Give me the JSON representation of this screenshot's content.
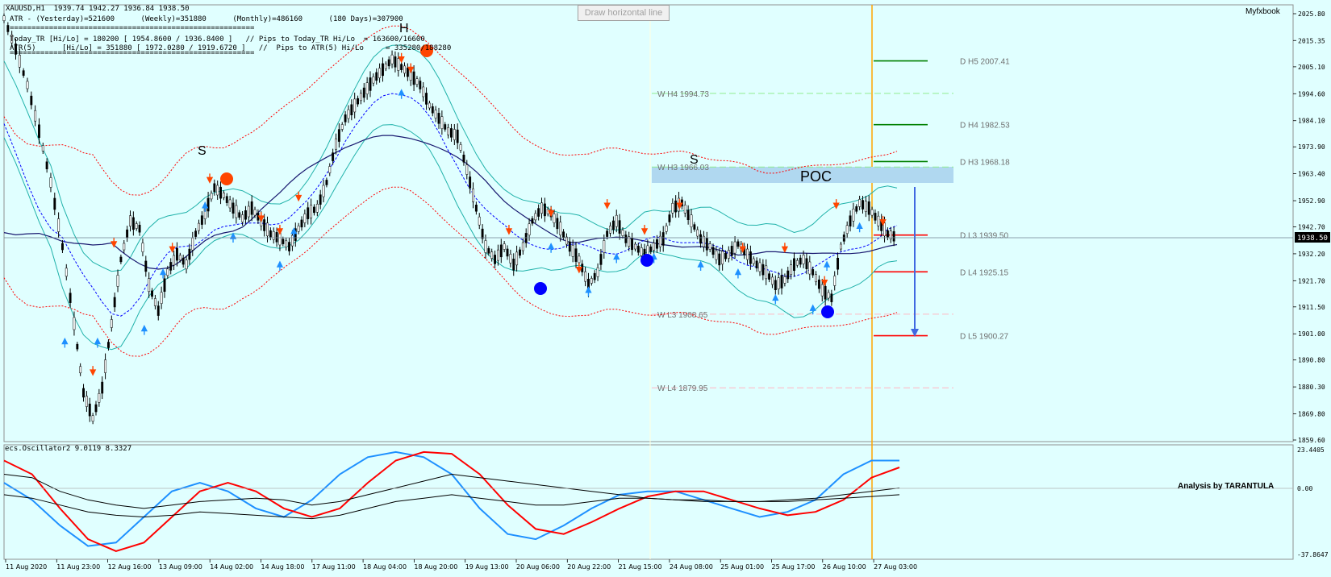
{
  "header": {
    "line1": "XAUUSD,H1  1939.74 1942.27 1936.84 1938.50",
    "line2": "ATR - (Yesterday)=521600      (Weekly)=351880      (Monthly)=486160      (180 Days)=307900",
    "line3": "========================================================",
    "line4": "Today_TR [Hi/Lo] = 180200 [ 1954.8600 / 1936.8400 ]   // Pips to Today_TR Hi/Lo  = 163600/16600",
    "line5": "ATR(5)      [Hi/Lo] = 351880 [ 1972.0280 / 1919.6720 ]   //  Pips to ATR(5) Hi/Lo     = 335280/188280",
    "line6": "========================================================"
  },
  "tooltip": "Draw horizontal line",
  "brand": "Myfxbook",
  "analysis": "Analysis by TARANTULA",
  "oscillator": {
    "title": "ecs.Oscillator2 9.0119 8.3327",
    "axis_labels": [
      "23.4405",
      "0.00",
      "-37.8647"
    ]
  },
  "colors": {
    "background": "#e0ffff",
    "bull_candle": "#000000",
    "bollinger": "#20b2aa",
    "envelope": "#ff0000",
    "ma": "#191970",
    "dotted_ma": "#0000ff",
    "arrow_down": "#ff4500",
    "arrow_up": "#1e90ff",
    "poc_zone": "#b0d8f0",
    "orange_line": "#ffa500"
  },
  "patterns": {
    "left_shoulder": "S",
    "head": "H",
    "right_shoulder": "S",
    "poc": "POC"
  },
  "chart_data": {
    "type": "candlestick",
    "symbol": "XAUUSD",
    "timeframe": "H1",
    "ylim": [
      1859.6,
      2025.8
    ],
    "y_ticks": [
      "2025.80",
      "2015.35",
      "2005.10",
      "1994.60",
      "1984.10",
      "1973.90",
      "1963.40",
      "1952.90",
      "1942.70",
      "1932.20",
      "1921.70",
      "1911.50",
      "1901.00",
      "1890.80",
      "1880.30",
      "1869.80",
      "1859.60"
    ],
    "last_price": "1938.50",
    "x_ticks": [
      "11 Aug 2020",
      "11 Aug 23:00",
      "12 Aug 16:00",
      "13 Aug 09:00",
      "14 Aug 02:00",
      "14 Aug 18:00",
      "17 Aug 11:00",
      "18 Aug 04:00",
      "18 Aug 20:00",
      "19 Aug 13:00",
      "20 Aug 06:00",
      "20 Aug 22:00",
      "21 Aug 15:00",
      "24 Aug 08:00",
      "25 Aug 01:00",
      "25 Aug 17:00",
      "26 Aug 10:00",
      "27 Aug 03:00"
    ],
    "path_points": [
      [
        0,
        2024
      ],
      [
        5,
        2012
      ],
      [
        10,
        1998
      ],
      [
        15,
        1980
      ],
      [
        20,
        1960
      ],
      [
        25,
        1935
      ],
      [
        30,
        1905
      ],
      [
        34,
        1878
      ],
      [
        38,
        1868
      ],
      [
        42,
        1880
      ],
      [
        46,
        1905
      ],
      [
        50,
        1930
      ],
      [
        54,
        1945
      ],
      [
        58,
        1942
      ],
      [
        62,
        1920
      ],
      [
        66,
        1910
      ],
      [
        70,
        1925
      ],
      [
        74,
        1932
      ],
      [
        78,
        1928
      ],
      [
        82,
        1940
      ],
      [
        86,
        1948
      ],
      [
        90,
        1958
      ],
      [
        94,
        1955
      ],
      [
        98,
        1950
      ],
      [
        102,
        1946
      ],
      [
        106,
        1950
      ],
      [
        110,
        1945
      ],
      [
        114,
        1940
      ],
      [
        118,
        1938
      ],
      [
        122,
        1935
      ],
      [
        126,
        1942
      ],
      [
        130,
        1948
      ],
      [
        134,
        1950
      ],
      [
        138,
        1960
      ],
      [
        142,
        1975
      ],
      [
        146,
        1985
      ],
      [
        150,
        1990
      ],
      [
        154,
        1995
      ],
      [
        158,
        2000
      ],
      [
        162,
        2004
      ],
      [
        166,
        2008
      ],
      [
        170,
        2005
      ],
      [
        174,
        2002
      ],
      [
        178,
        1998
      ],
      [
        182,
        1990
      ],
      [
        186,
        1985
      ],
      [
        190,
        1980
      ],
      [
        194,
        1978
      ],
      [
        198,
        1965
      ],
      [
        202,
        1950
      ],
      [
        206,
        1935
      ],
      [
        210,
        1930
      ],
      [
        214,
        1935
      ],
      [
        218,
        1928
      ],
      [
        222,
        1935
      ],
      [
        226,
        1945
      ],
      [
        230,
        1950
      ],
      [
        234,
        1948
      ],
      [
        238,
        1942
      ],
      [
        242,
        1935
      ],
      [
        246,
        1930
      ],
      [
        250,
        1920
      ],
      [
        254,
        1925
      ],
      [
        258,
        1940
      ],
      [
        262,
        1945
      ],
      [
        266,
        1938
      ],
      [
        270,
        1935
      ],
      [
        274,
        1932
      ],
      [
        278,
        1935
      ],
      [
        282,
        1938
      ],
      [
        286,
        1950
      ],
      [
        290,
        1952
      ],
      [
        294,
        1945
      ],
      [
        298,
        1938
      ],
      [
        302,
        1935
      ],
      [
        306,
        1930
      ],
      [
        310,
        1932
      ],
      [
        314,
        1936
      ],
      [
        318,
        1932
      ],
      [
        322,
        1928
      ],
      [
        326,
        1925
      ],
      [
        330,
        1920
      ],
      [
        334,
        1922
      ],
      [
        338,
        1928
      ],
      [
        342,
        1930
      ],
      [
        346,
        1925
      ],
      [
        350,
        1918
      ],
      [
        354,
        1915
      ],
      [
        358,
        1935
      ],
      [
        362,
        1945
      ],
      [
        366,
        1952
      ],
      [
        370,
        1950
      ],
      [
        374,
        1945
      ],
      [
        378,
        1940
      ],
      [
        382,
        1938.5
      ]
    ],
    "levels": [
      {
        "label": "D  H5 2007.41",
        "value": 2007.41,
        "color": "#008000",
        "style": "solid"
      },
      {
        "label": "W  H4 1994.73",
        "value": 1994.73,
        "color": "#90ee90",
        "style": "dashed"
      },
      {
        "label": "D  H4 1982.53",
        "value": 1982.53,
        "color": "#008000",
        "style": "solid"
      },
      {
        "label": "D  H3 1968.18",
        "value": 1968.18,
        "color": "#008000",
        "style": "solid"
      },
      {
        "label": "W  H3 1966.03",
        "value": 1966.03,
        "color": "#90ee90",
        "style": "dashed"
      },
      {
        "label": "D  L3 1939.50",
        "value": 1939.5,
        "color": "#ff0000",
        "style": "solid"
      },
      {
        "label": "D  L4 1925.15",
        "value": 1925.15,
        "color": "#ff0000",
        "style": "solid"
      },
      {
        "label": "W  L3 1908.65",
        "value": 1908.65,
        "color": "#ffb6c1",
        "style": "dashed"
      },
      {
        "label": "D  L5 1900.27",
        "value": 1900.27,
        "color": "#ff0000",
        "style": "solid"
      },
      {
        "label": "W  L4 1879.95",
        "value": 1879.95,
        "color": "#ffb6c1",
        "style": "dashed"
      }
    ],
    "oscillator": {
      "ylim": [
        -37.8647,
        23.4405
      ],
      "series": [
        {
          "color": "#1e90ff",
          "values": [
            5,
            -5,
            -20,
            -32,
            -30,
            -15,
            0,
            5,
            0,
            -10,
            -15,
            -5,
            10,
            20,
            23,
            20,
            10,
            -10,
            -25,
            -28,
            -20,
            -10,
            -2,
            0,
            0,
            -5,
            -10,
            -15,
            -12,
            -5,
            10,
            18,
            18
          ]
        },
        {
          "color": "#ff0000",
          "values": [
            18,
            10,
            -10,
            -28,
            -35,
            -30,
            -15,
            0,
            5,
            0,
            -10,
            -15,
            -10,
            5,
            18,
            23,
            22,
            10,
            -8,
            -22,
            -25,
            -18,
            -10,
            -3,
            0,
            0,
            -5,
            -10,
            -14,
            -12,
            -5,
            8,
            14
          ]
        }
      ]
    }
  }
}
